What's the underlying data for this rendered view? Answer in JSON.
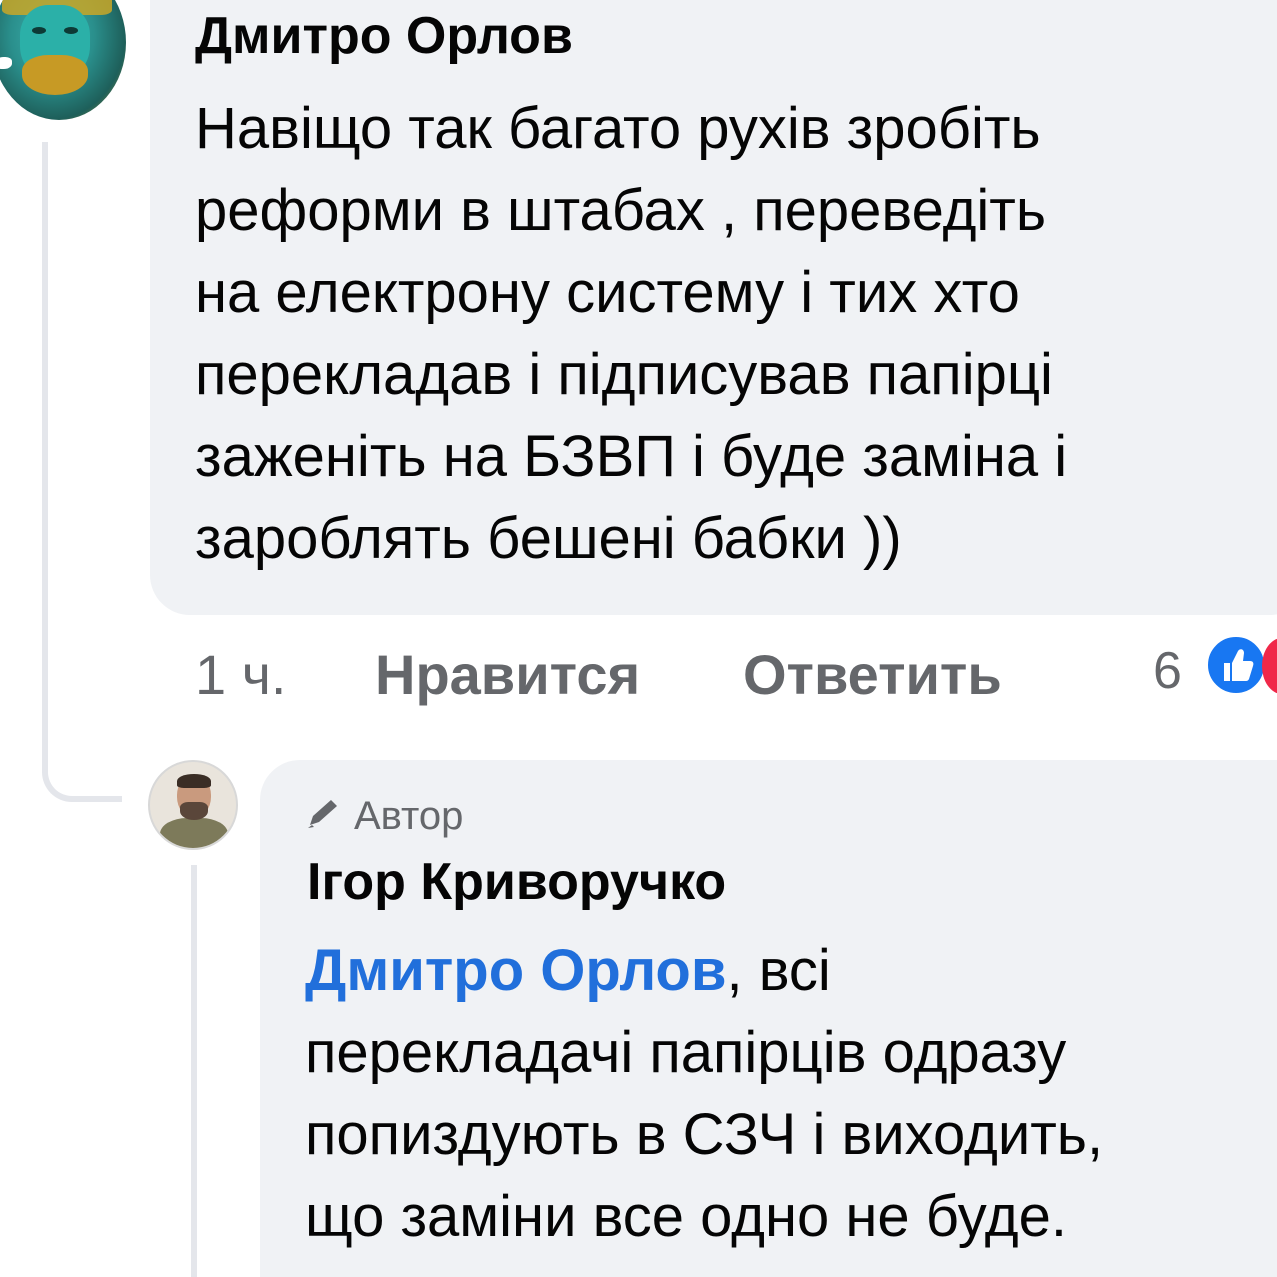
{
  "comment": {
    "author": "Дмитро Орлов",
    "lines": [
      "Навіщо так багато рухів зробіть",
      "реформи в штабах , переведіть",
      "на електрону систему і тих хто",
      "перекладав і підписував папірці",
      "заженіть на БЗВП і буде заміна і",
      "зароблять бешені бабки ))"
    ],
    "time": "1 ч.",
    "like_label": "Нравится",
    "reply_label": "Ответить",
    "reaction_count": "6",
    "reaction_icons": [
      "like-icon",
      "heart-icon"
    ]
  },
  "reply": {
    "badge_label": "Автор",
    "author": "Ігор Криворучко",
    "mention": "Дмитро Орлов",
    "first_line_rest": ", всі",
    "lines": [
      "перекладачі папірців одразу",
      "попиздують в СЗЧ і виходить,",
      "що заміни все одно не буде."
    ]
  },
  "colors": {
    "bubble": "#f0f2f5",
    "text": "#050505",
    "secondary": "#65676b",
    "mention": "#216fdb",
    "like_blue": "#1877f2",
    "heart_red": "#f02849"
  }
}
